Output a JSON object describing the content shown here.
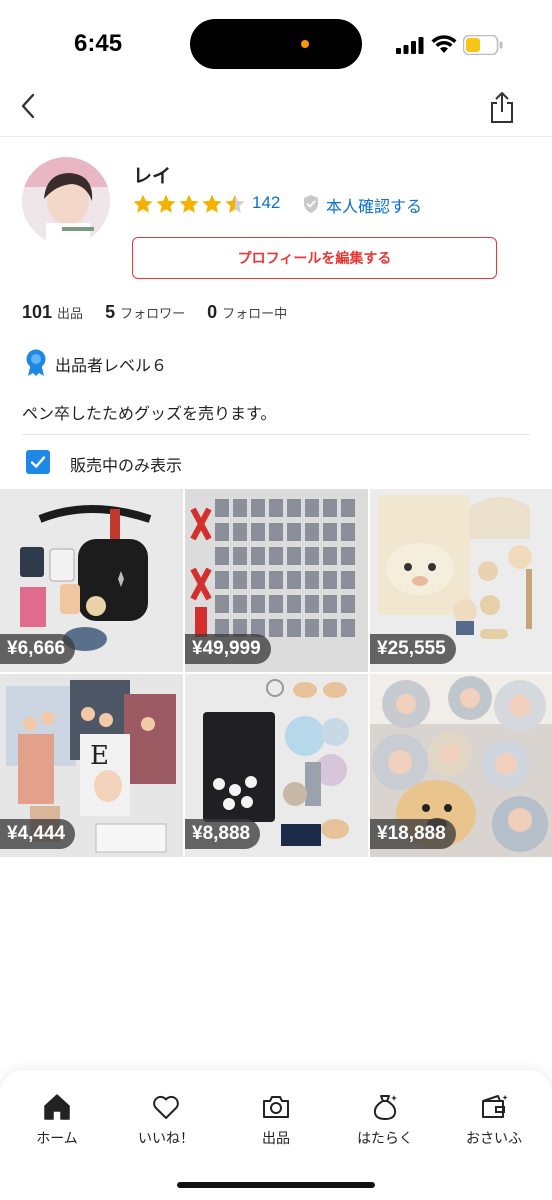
{
  "status_bar": {
    "time": "6:45"
  },
  "profile": {
    "name": "レイ",
    "rating_stars": 4.5,
    "review_count": "142",
    "verify_label": "本人確認する",
    "edit_button": "プロフィールを編集する"
  },
  "stats": [
    {
      "value": "101",
      "label": "出品"
    },
    {
      "value": "5",
      "label": "フォロワー"
    },
    {
      "value": "0",
      "label": "フォロー中"
    }
  ],
  "level": {
    "text": "出品者レベル６"
  },
  "bio": "ペン卒したためグッズを売ります。",
  "filter": {
    "label": "販売中のみ表示",
    "checked": true
  },
  "items": [
    {
      "price": "¥6,666"
    },
    {
      "price": "¥49,999"
    },
    {
      "price": "¥25,555"
    },
    {
      "price": "¥4,444"
    },
    {
      "price": "¥8,888"
    },
    {
      "price": "¥18,888"
    }
  ],
  "tab_bar": [
    {
      "label": "ホーム",
      "icon": "home-icon",
      "active": true
    },
    {
      "label": "いいね！",
      "icon": "heart-icon"
    },
    {
      "label": "出品",
      "icon": "camera-icon"
    },
    {
      "label": "はたらく",
      "icon": "money-bag-icon"
    },
    {
      "label": "おさいふ",
      "icon": "wallet-icon"
    }
  ],
  "colors": {
    "accent_red": "#e53935",
    "link_blue": "#0b6fd3",
    "star": "#f6b100",
    "checkbox_blue": "#1e88e5"
  }
}
